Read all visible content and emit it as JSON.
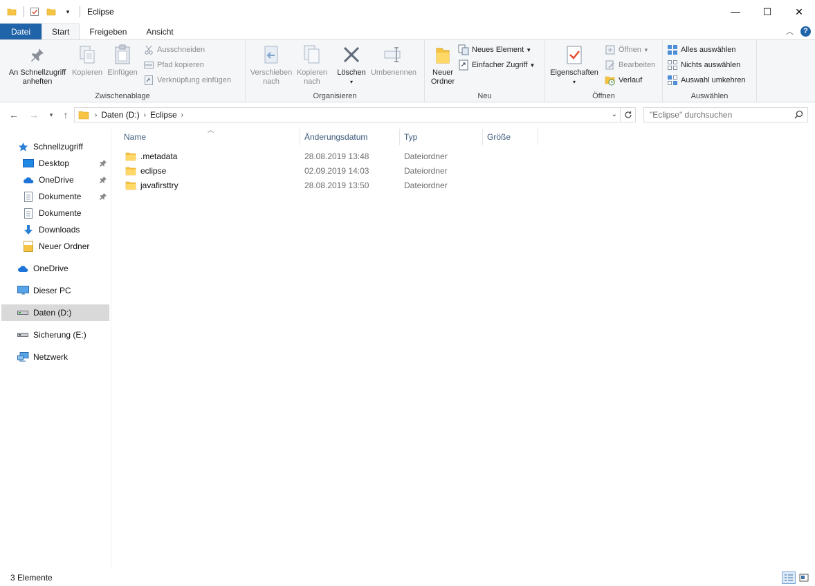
{
  "window": {
    "title": "Eclipse",
    "minimize": "—",
    "maximize": "☐",
    "close": "✕"
  },
  "ribbon_tabs": [
    {
      "label": "Datei"
    },
    {
      "label": "Start"
    },
    {
      "label": "Freigeben"
    },
    {
      "label": "Ansicht"
    }
  ],
  "ribbon": {
    "zwischenablage": {
      "label": "Zwischenablage",
      "pin": "An Schnellzugriff anheften",
      "copy": "Kopieren",
      "paste": "Einfügen",
      "cut": "Ausschneiden",
      "copy_path": "Pfad kopieren",
      "paste_shortcut": "Verknüpfung einfügen"
    },
    "organisieren": {
      "label": "Organisieren",
      "move_to": "Verschieben nach",
      "copy_to": "Kopieren nach",
      "delete": "Löschen",
      "rename": "Umbenennen"
    },
    "neu": {
      "label": "Neu",
      "new_folder": "Neuer Ordner",
      "new_item": "Neues Element",
      "easy_access": "Einfacher Zugriff"
    },
    "oeffnen": {
      "label": "Öffnen",
      "properties": "Eigenschaften",
      "open": "Öffnen",
      "edit": "Bearbeiten",
      "history": "Verlauf"
    },
    "auswaehlen": {
      "label": "Auswählen",
      "select_all": "Alles auswählen",
      "select_none": "Nichts auswählen",
      "invert": "Auswahl umkehren"
    }
  },
  "address": {
    "crumbs": [
      "Daten (D:)",
      "Eclipse"
    ],
    "search_placeholder": "\"Eclipse\" durchsuchen"
  },
  "nav_pane": {
    "quick_access": "Schnellzugriff",
    "items": [
      {
        "label": "Desktop"
      },
      {
        "label": "OneDrive"
      },
      {
        "label": "Dokumente"
      },
      {
        "label": "Dokumente"
      },
      {
        "label": "Downloads"
      },
      {
        "label": "Neuer Ordner"
      }
    ],
    "onedrive": "OneDrive",
    "this_pc": "Dieser PC",
    "drive_d": "Daten (D:)",
    "drive_e": "Sicherung (E:)",
    "network": "Netzwerk"
  },
  "columns": {
    "name": "Name",
    "date": "Änderungsdatum",
    "type": "Typ",
    "size": "Größe"
  },
  "files": [
    {
      "name": ".metadata",
      "date": "28.08.2019 13:48",
      "type": "Dateiordner"
    },
    {
      "name": "eclipse",
      "date": "02.09.2019 14:03",
      "type": "Dateiordner"
    },
    {
      "name": "javafirsttry",
      "date": "28.08.2019 13:50",
      "type": "Dateiordner"
    }
  ],
  "status": {
    "count": "3 Elemente"
  },
  "colors": {
    "accent": "#1f63a8",
    "folder": "#f6c342",
    "ribbon_bg": "#f5f6f7"
  }
}
